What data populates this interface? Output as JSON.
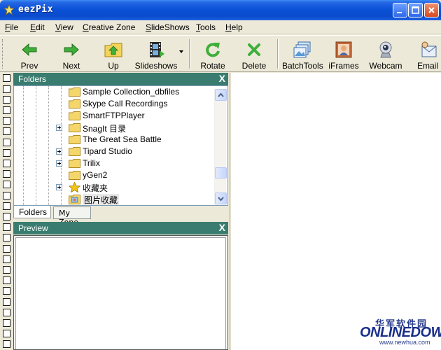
{
  "window": {
    "title": "eezPix"
  },
  "menu": [
    "File",
    "Edit",
    "View",
    "Creative Zone",
    "SlideShows",
    "Tools",
    "Help"
  ],
  "menu_underline": [
    "F",
    "E",
    "V",
    "C",
    "S",
    "T",
    "H"
  ],
  "menu_rest": [
    "ile",
    "dit",
    "iew",
    "reative Zone",
    "lideShows",
    "ools",
    "elp"
  ],
  "toolbar": {
    "prev": "Prev",
    "next": "Next",
    "up": "Up",
    "slideshows": "Slideshows",
    "rotate": "Rotate",
    "delete": "Delete",
    "batchtools": "BatchTools",
    "iframes": "iFrames",
    "webcam": "Webcam",
    "email": "Email"
  },
  "folders_panel": {
    "title": "Folders",
    "close": "X"
  },
  "tree": [
    "Sample Collection_dbfiles",
    "Skype Call Recordings",
    "SmartFTPPlayer",
    "SnagIt 目录",
    "The Great Sea Battle",
    "Tipard Studio",
    "Trilix",
    "yGen2",
    "收藏夹",
    "图片收藏"
  ],
  "tabs": {
    "folders": "Folders",
    "myzone": "My Zone"
  },
  "preview_panel": {
    "title": "Preview",
    "close": "X"
  },
  "watermark": {
    "cn": "华军软件园",
    "en": "ONLINEDOWN",
    "url": "www.newhua.com"
  },
  "colors": {
    "title_bar": "#0a52d8",
    "panel_header": "#3a7d70",
    "chrome": "#ece9d8"
  }
}
